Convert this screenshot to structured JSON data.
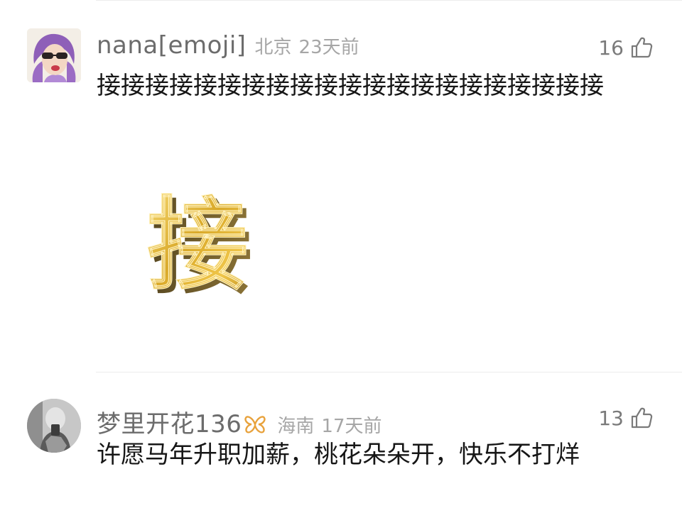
{
  "comments": [
    {
      "username": "nana[emoji]",
      "location": "北京",
      "time": "23天前",
      "likes": "16",
      "text": "接接接接接接接接接接接接接接接接接接接接接",
      "sticker": {
        "glyph": "接",
        "icon": "gold-character-sticker"
      }
    },
    {
      "username": "梦里开花136",
      "badge_icon": "butterfly-icon",
      "location": "海南",
      "time": "17天前",
      "likes": "13",
      "text": "许愿马年升职加薪，桃花朵朵开，快乐不打烊"
    }
  ],
  "colors": {
    "username": "#6c6c6c",
    "meta": "#a6a6a6",
    "text": "#161616",
    "badge": "#e8a23c",
    "sticker_gold": "#d9a92a"
  }
}
